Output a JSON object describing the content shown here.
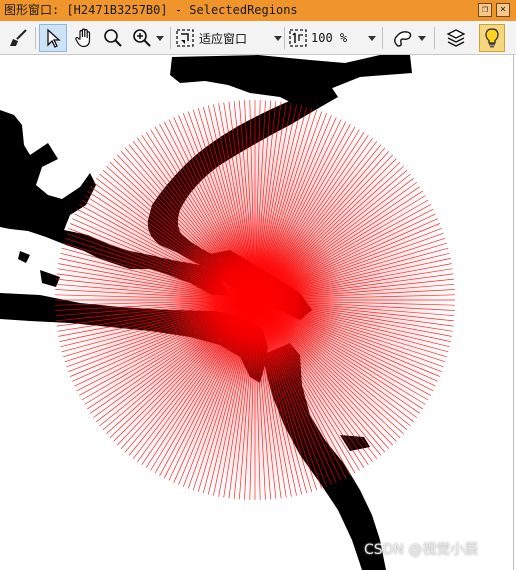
{
  "window": {
    "title": "图形窗口: [H2471B3257B0] - SelectedRegions"
  },
  "toolbar": {
    "tools": [
      {
        "name": "brush-icon",
        "label": "Clear"
      },
      {
        "name": "pointer-icon",
        "label": "Select",
        "selected": true
      },
      {
        "name": "hand-icon",
        "label": "Move"
      },
      {
        "name": "magnifier-icon",
        "label": "Zoom"
      },
      {
        "name": "zoom-in-icon",
        "label": "Zoom in"
      }
    ],
    "fit_label": "适应窗口",
    "zoom_value": "100 %",
    "layer_icon": "layers-icon",
    "bulb_icon": "lightbulb-icon",
    "bulb_active": true
  },
  "canvas": {
    "region_color": "#ff0000",
    "background_color": "#ffffff",
    "mask_color": "#000000",
    "ray_count": 240
  },
  "watermark": "CSDN @视觉小辰",
  "colors": {
    "titlebar": "#f0952b",
    "toolbar": "#f3f3f3",
    "selected_tool": "#cfe3f7",
    "bulb_active": "#f6d77e"
  }
}
